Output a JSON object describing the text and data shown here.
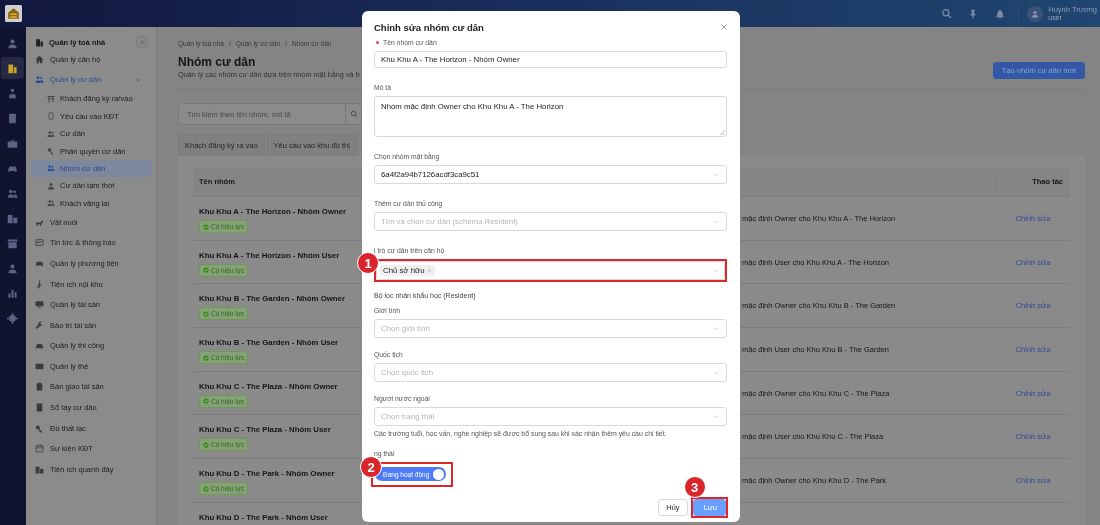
{
  "header": {
    "user_name": "Huỳnh Trường",
    "user_role": "user"
  },
  "rail": [
    {
      "selected": false
    },
    {
      "selected": true
    },
    {
      "selected": false
    },
    {
      "selected": false
    },
    {
      "selected": false
    },
    {
      "selected": false
    },
    {
      "selected": false
    },
    {
      "selected": false
    },
    {
      "selected": false
    },
    {
      "selected": false
    },
    {
      "selected": false
    },
    {
      "selected": false
    }
  ],
  "sidebar": {
    "title": "Quản lý toà nhà",
    "items": [
      {
        "label": "Quản lý căn hộ",
        "selected": false,
        "expanded": false
      },
      {
        "label": "Quản lý cư dân",
        "selected": false,
        "expanded": true,
        "children": [
          {
            "label": "Khách đăng ký ra/vào",
            "selected": false
          },
          {
            "label": "Yêu cầu vào KĐT",
            "selected": false
          },
          {
            "label": "Cư dân",
            "selected": false
          },
          {
            "label": "Phân quyền cư dân",
            "selected": false
          },
          {
            "label": "Nhóm cư dân",
            "selected": true
          },
          {
            "label": "Cư dân tạm thời",
            "selected": false
          },
          {
            "label": "Khách vãng lai",
            "selected": false
          }
        ]
      },
      {
        "label": "Vật nuôi",
        "selected": false,
        "expanded": false
      },
      {
        "label": "Tin tức & thông báo",
        "selected": false,
        "expanded": false
      },
      {
        "label": "Quản lý phương tiện",
        "selected": false,
        "expanded": false
      },
      {
        "label": "Tiện ích nội khu",
        "selected": false,
        "expanded": false
      },
      {
        "label": "Quản lý tài sản",
        "selected": false,
        "expanded": false
      },
      {
        "label": "Bảo trì tài sản",
        "selected": false,
        "expanded": false
      },
      {
        "label": "Quản lý thi công",
        "selected": false,
        "expanded": false
      },
      {
        "label": "Quản lý thẻ",
        "selected": false,
        "expanded": false
      },
      {
        "label": "Bàn giao tài sản",
        "selected": false,
        "expanded": false
      },
      {
        "label": "Sổ tay cư dân",
        "selected": false,
        "expanded": false
      },
      {
        "label": "Đồ thất lạc",
        "selected": false,
        "expanded": false
      },
      {
        "label": "Sự kiện KĐT",
        "selected": false,
        "expanded": false
      },
      {
        "label": "Tiện ích quanh đây",
        "selected": false,
        "expanded": false
      }
    ]
  },
  "breadcrumb": [
    {
      "label": "Quản lý toà nhà",
      "separator": "/"
    },
    {
      "label": "Quản lý cư dân",
      "separator": "/"
    },
    {
      "label": "Nhóm cư dân"
    }
  ],
  "page": {
    "title": "Nhóm cư dân",
    "subtitle": "Quản lý các nhóm cư dân dựa trên nhóm mặt bằng và b",
    "create_button": "Tạo nhóm cư dân mới"
  },
  "search": {
    "placeholder": "Tìm kiếm theo tên nhóm, mô tả"
  },
  "tabs": [
    {
      "label": "Khách đăng ký ra vào",
      "selected": false
    },
    {
      "label": "Yêu cầu vào khu đô thị",
      "selected": false
    }
  ],
  "table": {
    "columns": [
      "Tên nhóm",
      "Thao tác"
    ],
    "rows": [
      {
        "name": "Khu Khu A - The Horizon - Nhóm Owner",
        "status": "Có hiệu lực",
        "description": "mặc định Owner cho Khu Khu A - The Horizon",
        "action": "Chỉnh sửa"
      },
      {
        "name": "Khu Khu A - The Horizon - Nhóm User",
        "status": "Có hiệu lực",
        "description": "mặc định User cho Khu Khu A - The Horizon",
        "action": "Chỉnh sửa"
      },
      {
        "name": "Khu Khu B - The Garden - Nhóm Owner",
        "status": "Có hiệu lực",
        "description": "mặc định Owner cho Khu Khu B - The Garden",
        "action": "Chỉnh sửa"
      },
      {
        "name": "Khu Khu B - The Garden - Nhóm User",
        "status": "Có hiệu lực",
        "description": "mặc định User cho Khu Khu B - The Garden",
        "action": "Chỉnh sửa"
      },
      {
        "name": "Khu Khu C - The Plaza - Nhóm Owner",
        "status": "Có hiệu lực",
        "description": "mặc định Owner cho Khu Khu C - The Plaza",
        "action": "Chỉnh sửa"
      },
      {
        "name": "Khu Khu C - The Plaza - Nhóm User",
        "status": "Có hiệu lực",
        "description": "mặc định User cho Khu Khu C - The Plaza",
        "action": "Chỉnh sửa"
      },
      {
        "name": "Khu Khu D - The Park - Nhóm Owner",
        "status": "Có hiệu lực",
        "description": "mặc định Owner cho Khu Khu D - The Park",
        "action": "Chỉnh sửa"
      },
      {
        "name": "Khu Khu D - The Park - Nhóm User"
      }
    ]
  },
  "modal": {
    "title": "Chỉnh sửa nhóm cư dân",
    "fields": [
      {
        "kind": "input",
        "label": "Tên nhóm cư dân",
        "required": true,
        "value": "Khu Khu A - The Horizon - Nhóm Owner"
      },
      {
        "kind": "textarea",
        "label": "Mô tả",
        "value": "Nhóm mặc định Owner cho Khu Khu A - The Horizon"
      },
      {
        "kind": "select",
        "label": "Chọn nhóm mặt bằng",
        "value": "6a4f2a94b7126acdf3ca9c51"
      },
      {
        "kind": "select",
        "label": "Thêm cư dân thủ công",
        "placeholder": "Tìm và chọn cư dân (schema Resident)"
      },
      {
        "kind": "tags",
        "label": "i trò cư dân trên căn hộ",
        "tags": [
          "Chủ sở hữu"
        ],
        "highlighted": true,
        "callout": "1"
      },
      {
        "kind": "heading",
        "label": "Bộ lọc nhân khẩu học (Resident)"
      },
      {
        "kind": "select",
        "label": "Giới tính",
        "placeholder": "Chọn giới tính"
      },
      {
        "kind": "select",
        "label": "Quốc tịch",
        "placeholder": "Chọn quốc tịch"
      },
      {
        "kind": "select",
        "label": "Người nước ngoài",
        "placeholder": "Chọn trạng thái",
        "help": "Các trường tuổi, học vấn, nghề nghiệp sẽ được bổ sung sau khi xác nhận thêm yêu cầu chi tiết."
      },
      {
        "kind": "toggle",
        "label": "ng thái",
        "on": true,
        "value_label": "Đang hoạt động",
        "highlighted": true,
        "callout": "2"
      }
    ],
    "buttons": [
      {
        "label": "Hủy",
        "kind": "default",
        "highlighted": false
      },
      {
        "label": "Lưu",
        "kind": "primary",
        "highlighted": true,
        "callout": "3"
      }
    ]
  }
}
